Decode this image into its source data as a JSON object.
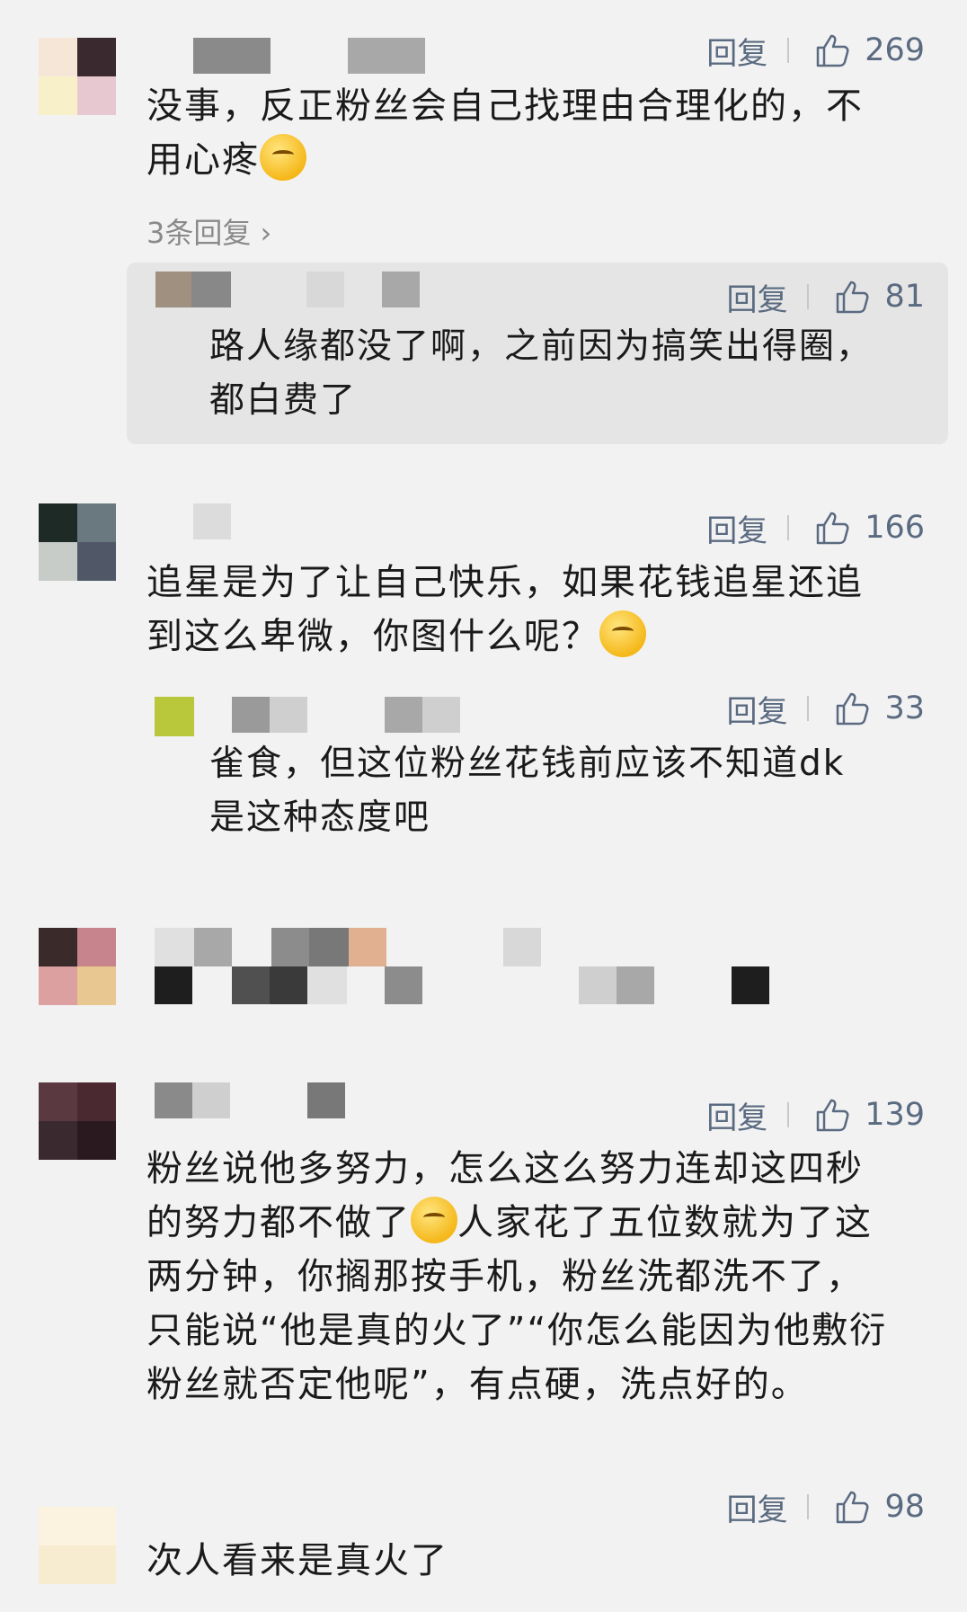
{
  "common": {
    "reply_label": "回复",
    "thumb_icon": "thumbs-up-icon"
  },
  "comments": [
    {
      "likes": "269",
      "text_lines": [
        "没事，反正粉丝会自己找理由合理化的，不",
        "用心疼"
      ],
      "more_replies": "3条回复",
      "reply": {
        "likes": "81",
        "text_lines": [
          "路人缘都没了啊，之前因为搞笑出得圈，",
          "都白费了"
        ]
      }
    },
    {
      "likes": "166",
      "text_lines": [
        "追星是为了让自己快乐，如果花钱追星还追",
        "到这么卑微，你图什么呢？"
      ],
      "reply": {
        "likes": "33",
        "text_lines": [
          "雀食，但这位粉丝花钱前应该不知道dk",
          "是这种态度吧"
        ]
      }
    },
    {
      "likes": "139",
      "text_lines": [
        "粉丝说他多努力，怎么这么努力连却这四秒",
        "的努力都不做了",
        "人家花了五位数就为了这",
        "两分钟，你搁那按手机，粉丝洗都洗不了，",
        "只能说“他是真的火了”“你怎么能因为他敷衍",
        "粉丝就否定他呢”，有点硬，洗点好的。"
      ]
    },
    {
      "likes": "98",
      "text_lines": [
        "次人看来是真火了"
      ]
    }
  ]
}
